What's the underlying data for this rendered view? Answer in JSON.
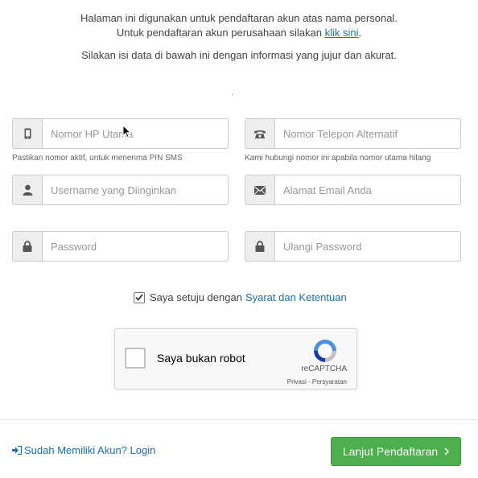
{
  "intro": {
    "line1": "Halaman ini digunakan untuk pendaftaran akun atas nama personal.",
    "line2_prefix": "Untuk pendaftaran akun perusahaan silakan ",
    "line2_link": "klik sini",
    "line2_suffix": ".",
    "line3": "Silakan isi data di bawah ini dengan informasi yang jujur dan akurat."
  },
  "fields": {
    "phone_main": {
      "placeholder": "Nomor HP Utama",
      "help": "Pastikan nomor aktif, untuk menerima PIN SMS",
      "icon": "mobile-icon"
    },
    "phone_alt": {
      "placeholder": "Nomor Telepon Alternatif",
      "help": "Kami hubungi nomor ini apabila nomor utama hilang",
      "icon": "phone-icon"
    },
    "username": {
      "placeholder": "Username yang Diinginkan",
      "icon": "user-icon"
    },
    "email": {
      "placeholder": "Alamat Email Anda",
      "icon": "envelope-icon"
    },
    "password": {
      "placeholder": "Password",
      "icon": "lock-icon"
    },
    "password_repeat": {
      "placeholder": "Ulangi Password",
      "icon": "lock-icon"
    }
  },
  "agreement": {
    "checked": true,
    "label": "Saya setuju dengan",
    "link": "Syarat dan Ketentuan"
  },
  "captcha": {
    "label": "Saya bukan robot",
    "brand": "reCAPTCHA",
    "links": "Privasi - Persyaratan"
  },
  "footer": {
    "login_link": "Sudah Memiliki Akun? Login",
    "next_button": "Lanjut Pendaftaran",
    "next_color": "#4cae4c"
  }
}
